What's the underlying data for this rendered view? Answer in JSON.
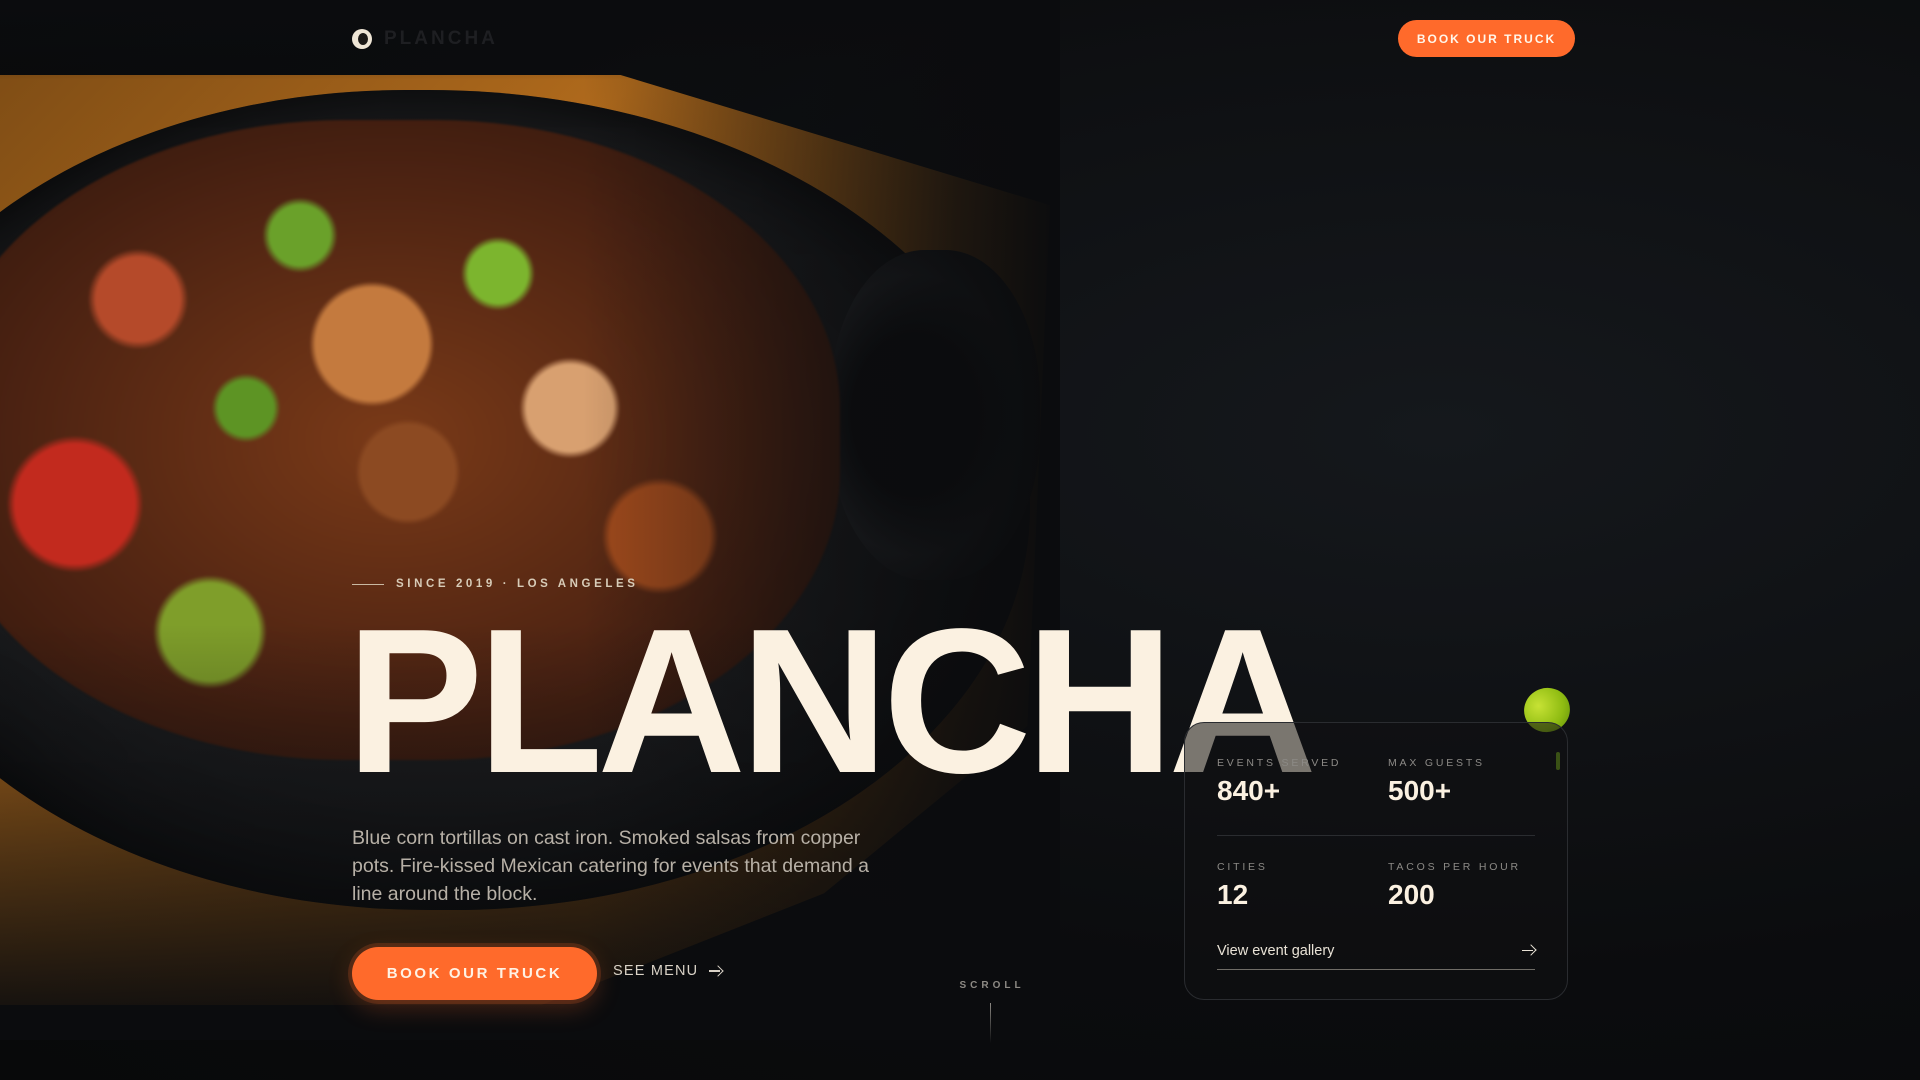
{
  "nav": {
    "brand": "PLANCHA",
    "cta_label": "BOOK OUR TRUCK"
  },
  "hero": {
    "eyebrow": "SINCE 2019 · LOS ANGELES",
    "title": "PLANCHA",
    "description": "Blue corn tortillas on cast iron. Smoked salsas from copper pots. Fire-kissed Mexican catering for events that demand a line around the block.",
    "primary_cta": "BOOK OUR TRUCK",
    "secondary_cta": "SEE MENU"
  },
  "scroll": {
    "label": "SCROLL"
  },
  "stats": {
    "items": [
      {
        "label": "EVENTS SERVED",
        "value": "840+"
      },
      {
        "label": "MAX GUESTS",
        "value": "500+"
      },
      {
        "label": "CITIES",
        "value": "12"
      },
      {
        "label": "TACOS PER HOUR",
        "value": "200"
      }
    ],
    "link_label": "View event gallery"
  },
  "colors": {
    "accent": "#ff6a2b",
    "background": "#0b0c0e",
    "title_cream": "#fbf1e1",
    "lime": "#a7cc1c"
  },
  "icons": {
    "logo": "logo-mark-icon",
    "arrow": "arrow-right-icon",
    "lime": "lime-icon"
  }
}
